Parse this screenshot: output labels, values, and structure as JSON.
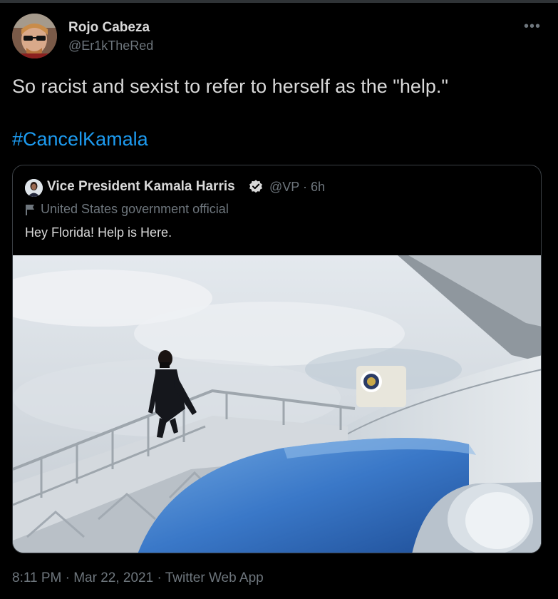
{
  "tweet": {
    "author_name": "Rojo Cabeza",
    "author_handle": "@Er1kTheRed",
    "more_icon": "more-icon",
    "text": "So racist and sexist to refer to herself as the \"help.\"",
    "hashtag": "#CancelKamala",
    "timestamp": "8:11 PM · Mar 22, 2021 · Twitter Web App"
  },
  "quoted": {
    "author_name": "Vice President Kamala Harris",
    "handle_time": "@VP · 6h",
    "label": "United States government official",
    "text": "Hey Florida! Help is Here.",
    "verified_icon": "verified-badge-icon",
    "flag_icon": "flag-icon"
  },
  "colors": {
    "background": "#000000",
    "text": "#d9d9d9",
    "muted": "#6e767d",
    "link": "#1d9bf0",
    "border": "#3a3f44"
  }
}
